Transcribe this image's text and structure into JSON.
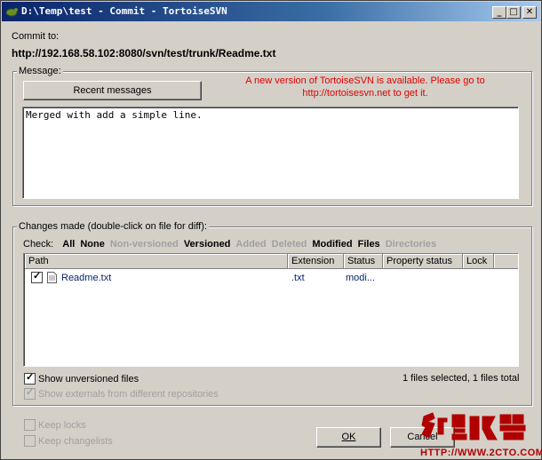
{
  "window": {
    "title": "D:\\Temp\\test - Commit - TortoiseSVN",
    "controls": {
      "minimize": "_",
      "maximize": "□",
      "close": "✕"
    }
  },
  "commit": {
    "label": "Commit to:",
    "url": "http://192.168.58.102:8080/svn/test/trunk/Readme.txt"
  },
  "message": {
    "group_label": "Message:",
    "recent_button": "Recent messages",
    "notice_line1": "A new version of TortoiseSVN is available. Please go to",
    "notice_line2": "http://tortoisesvn.net to get it.",
    "text": "Merged with add a simple line."
  },
  "changes": {
    "group_label": "Changes made (double-click on file for diff):",
    "check_label": "Check:",
    "filters": [
      "All",
      "None",
      "Non-versioned",
      "Versioned",
      "Added",
      "Deleted",
      "Modified",
      "Files",
      "Directories"
    ],
    "columns": [
      "Path",
      "Extension",
      "Status",
      "Property status",
      "Lock"
    ],
    "rows": [
      {
        "checked": true,
        "path": "Readme.txt",
        "extension": ".txt",
        "status": "modi..."
      }
    ],
    "show_unversioned": "Show unversioned files",
    "show_externals": "Show externals from different repositories",
    "summary": "1 files selected, 1 files total"
  },
  "options": {
    "keep_locks": "Keep locks",
    "keep_changelists": "Keep changelists"
  },
  "buttons": {
    "ok": "OK",
    "cancel": "Cancel"
  },
  "watermark": {
    "text": "HTTP://WWW.2CTO.COM"
  }
}
